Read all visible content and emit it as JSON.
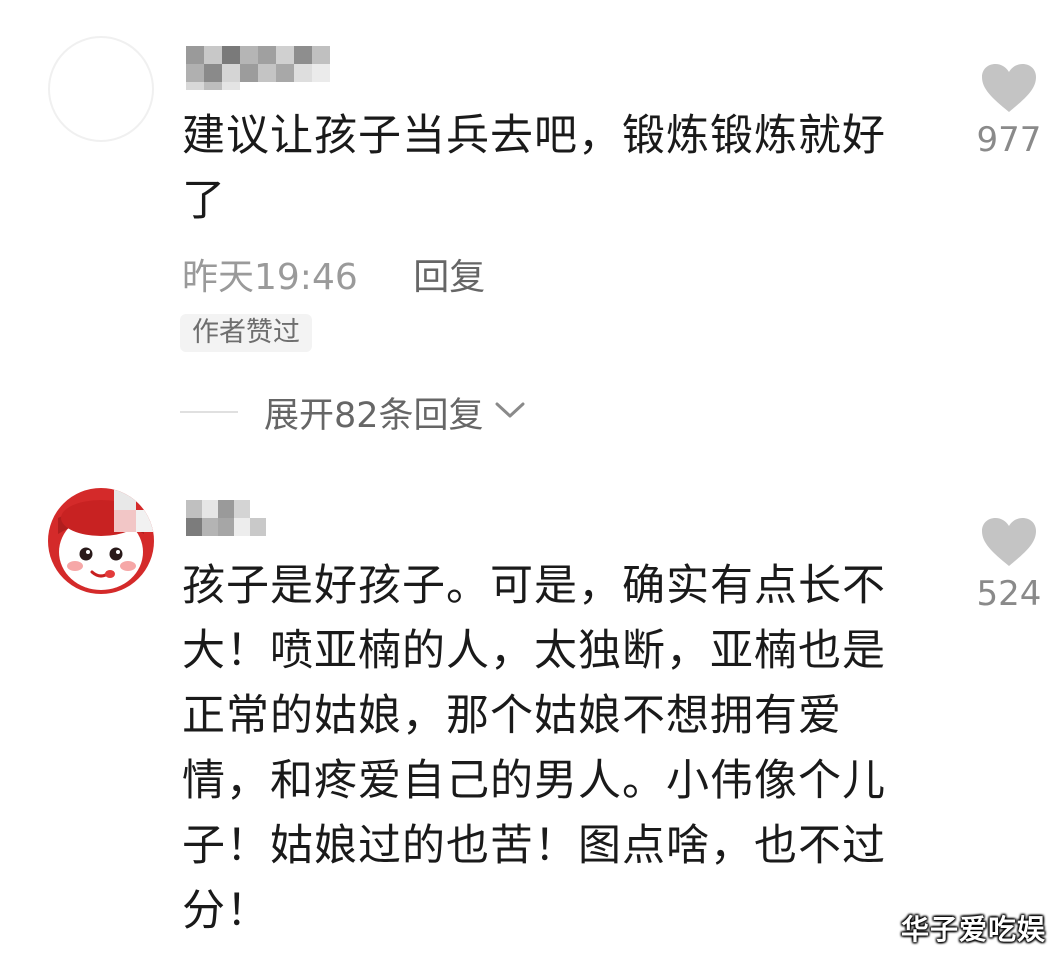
{
  "comments": [
    {
      "text": "建议让孩子当兵去吧，锻炼锻炼就好了",
      "timestamp": "昨天19:46",
      "reply_label": "回复",
      "author_badge": "作者赞过",
      "expand_label": "展开82条回复",
      "likes": "977"
    },
    {
      "text": "孩子是好孩子。可是，确实有点长不大！喷亚楠的人，太独断，亚楠也是正常的姑娘，那个姑娘不想拥有爱情，和疼爱自己的男人。小伟像个儿子！姑娘过的也苦！图点啥，也不过分！",
      "likes": "524"
    }
  ],
  "watermark": "华子爱吃娱",
  "colors": {
    "primary_text": "#1a1a1a",
    "meta_text": "#9a9a9a",
    "like_icon": "#c4c4c4",
    "badge_bg": "#f3f3f3",
    "avatar_red": "#d42a2a"
  },
  "icons": {
    "like": "heart-icon",
    "expand": "chevron-down-icon"
  }
}
